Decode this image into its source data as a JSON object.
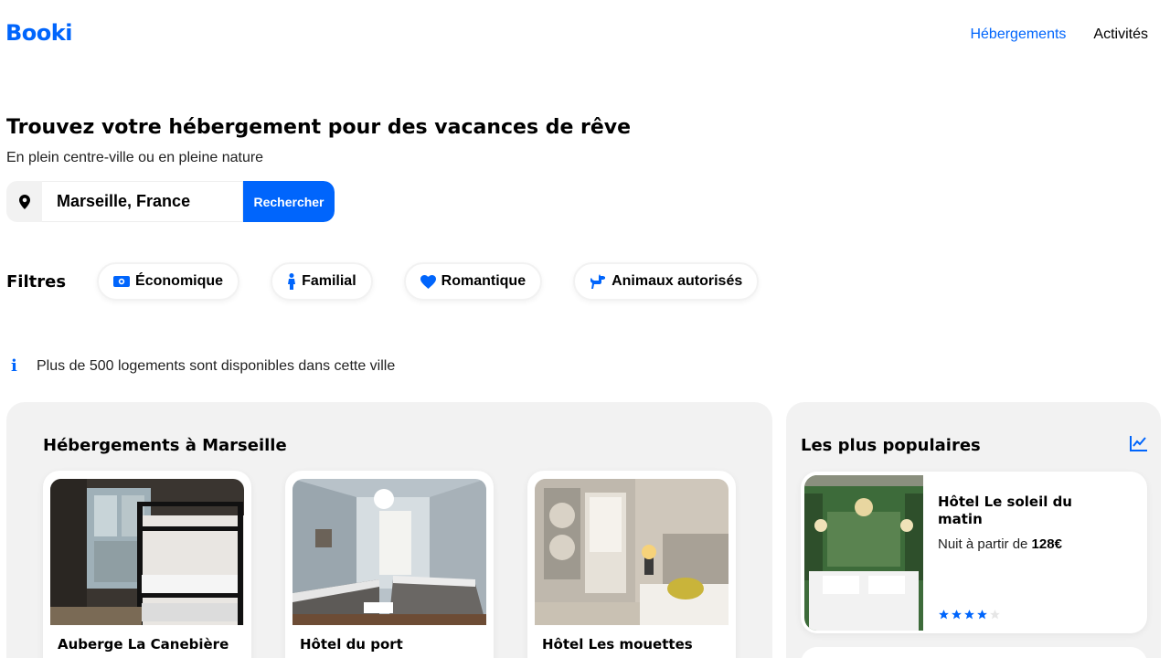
{
  "header": {
    "logo": "Booki",
    "nav": [
      {
        "label": "Hébergements",
        "active": true
      },
      {
        "label": "Activités",
        "active": false
      }
    ]
  },
  "hero": {
    "title": "Trouvez votre hébergement pour des vacances de rêve",
    "subtitle": "En plein centre-ville ou en pleine nature"
  },
  "search": {
    "value": "Marseille, France",
    "button_label": "Rechercher",
    "icon": "map-pin-icon"
  },
  "filters": {
    "label": "Filtres",
    "items": [
      {
        "label": "Économique",
        "icon": "money-icon"
      },
      {
        "label": "Familial",
        "icon": "person-icon"
      },
      {
        "label": "Romantique",
        "icon": "heart-icon"
      },
      {
        "label": "Animaux autorisés",
        "icon": "dog-icon"
      }
    ]
  },
  "info": {
    "text": "Plus de 500 logements sont disponibles dans cette ville",
    "icon": "info-icon"
  },
  "listings": {
    "title": "Hébergements à Marseille",
    "items": [
      {
        "name": "Auberge La Canebière"
      },
      {
        "name": "Hôtel du port"
      },
      {
        "name": "Hôtel Les mouettes"
      }
    ]
  },
  "popular": {
    "title": "Les plus populaires",
    "icon": "trending-up-icon",
    "items": [
      {
        "name": "Hôtel Le soleil du matin",
        "price_prefix": "Nuit à partir de ",
        "price": "128€",
        "rating": 4,
        "max_rating": 5
      }
    ]
  },
  "colors": {
    "accent": "#0065FC",
    "panel": "#F2F2F2"
  }
}
